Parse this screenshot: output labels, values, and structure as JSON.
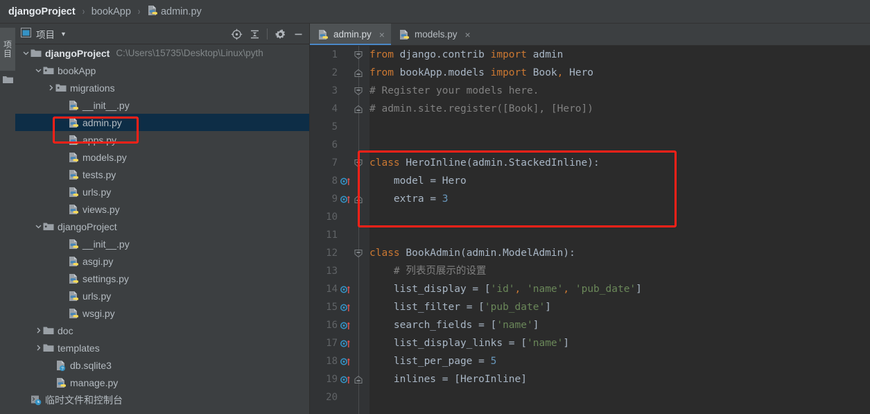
{
  "breadcrumb": {
    "items": [
      {
        "label": "djangoProject",
        "icon": null,
        "root": true
      },
      {
        "label": "bookApp",
        "icon": null,
        "root": false
      },
      {
        "label": "admin.py",
        "icon": "python-file-icon",
        "root": false
      }
    ],
    "separator": "›"
  },
  "toolstrip": {
    "project_tab_label": "项目",
    "folder_icon": "folder-icon"
  },
  "project_panel": {
    "title": "项目",
    "title_icon": "project-window-icon",
    "caret": "▼",
    "actions": [
      {
        "name": "select-opened-file-icon",
        "label": "Select Opened File"
      },
      {
        "name": "collapse-all-icon",
        "label": "Collapse All"
      },
      {
        "name": "settings-gear-icon",
        "label": "Settings"
      },
      {
        "name": "hide-panel-icon",
        "label": "Hide"
      }
    ],
    "tree": [
      {
        "indent": 0,
        "arrow": "down",
        "icon": "folder-icon",
        "label": "djangoProject",
        "bold": true,
        "path": "C:\\Users\\15735\\Desktop\\Linux\\pyth",
        "selected": false
      },
      {
        "indent": 1,
        "arrow": "down",
        "icon": "module-folder-icon",
        "label": "bookApp",
        "bold": false,
        "path": "",
        "selected": false
      },
      {
        "indent": 2,
        "arrow": "right",
        "icon": "module-folder-icon",
        "label": "migrations",
        "bold": false,
        "path": "",
        "selected": false
      },
      {
        "indent": 3,
        "arrow": "none",
        "icon": "python-file-icon",
        "label": "__init__.py",
        "bold": false,
        "path": "",
        "selected": false
      },
      {
        "indent": 3,
        "arrow": "none",
        "icon": "python-file-icon",
        "label": "admin.py",
        "bold": false,
        "path": "",
        "selected": true
      },
      {
        "indent": 3,
        "arrow": "none",
        "icon": "python-file-icon",
        "label": "apps.py",
        "bold": false,
        "path": "",
        "selected": false
      },
      {
        "indent": 3,
        "arrow": "none",
        "icon": "python-file-icon",
        "label": "models.py",
        "bold": false,
        "path": "",
        "selected": false
      },
      {
        "indent": 3,
        "arrow": "none",
        "icon": "python-file-icon",
        "label": "tests.py",
        "bold": false,
        "path": "",
        "selected": false
      },
      {
        "indent": 3,
        "arrow": "none",
        "icon": "python-file-icon",
        "label": "urls.py",
        "bold": false,
        "path": "",
        "selected": false
      },
      {
        "indent": 3,
        "arrow": "none",
        "icon": "python-file-icon",
        "label": "views.py",
        "bold": false,
        "path": "",
        "selected": false
      },
      {
        "indent": 1,
        "arrow": "down",
        "icon": "module-folder-icon",
        "label": "djangoProject",
        "bold": false,
        "path": "",
        "selected": false
      },
      {
        "indent": 3,
        "arrow": "none",
        "icon": "python-file-icon",
        "label": "__init__.py",
        "bold": false,
        "path": "",
        "selected": false
      },
      {
        "indent": 3,
        "arrow": "none",
        "icon": "python-file-icon",
        "label": "asgi.py",
        "bold": false,
        "path": "",
        "selected": false
      },
      {
        "indent": 3,
        "arrow": "none",
        "icon": "python-file-icon",
        "label": "settings.py",
        "bold": false,
        "path": "",
        "selected": false
      },
      {
        "indent": 3,
        "arrow": "none",
        "icon": "python-file-icon",
        "label": "urls.py",
        "bold": false,
        "path": "",
        "selected": false
      },
      {
        "indent": 3,
        "arrow": "none",
        "icon": "python-file-icon",
        "label": "wsgi.py",
        "bold": false,
        "path": "",
        "selected": false
      },
      {
        "indent": 1,
        "arrow": "right",
        "icon": "folder-icon",
        "label": "doc",
        "bold": false,
        "path": "",
        "selected": false
      },
      {
        "indent": 1,
        "arrow": "right",
        "icon": "folder-icon",
        "label": "templates",
        "bold": false,
        "path": "",
        "selected": false
      },
      {
        "indent": 2,
        "arrow": "none",
        "icon": "unknown-file-icon",
        "label": "db.sqlite3",
        "bold": false,
        "path": "",
        "selected": false
      },
      {
        "indent": 2,
        "arrow": "none",
        "icon": "python-file-icon",
        "label": "manage.py",
        "bold": false,
        "path": "",
        "selected": false
      },
      {
        "indent": 0,
        "arrow": "none",
        "icon": "scratches-icon",
        "label": "临时文件和控制台",
        "bold": false,
        "path": "",
        "selected": false
      }
    ]
  },
  "editor": {
    "tabs": [
      {
        "label": "admin.py",
        "icon": "python-file-icon",
        "active": true,
        "close": "×"
      },
      {
        "label": "models.py",
        "icon": "python-file-icon",
        "active": false,
        "close": "×"
      }
    ],
    "lines": [
      {
        "num": "1",
        "fold": "open",
        "over": false,
        "tokens": [
          {
            "t": "from",
            "c": "kw"
          },
          {
            "t": " django.contrib ",
            "c": "id"
          },
          {
            "t": "import",
            "c": "kw"
          },
          {
            "t": " admin",
            "c": "id"
          }
        ]
      },
      {
        "num": "2",
        "fold": "close",
        "over": false,
        "tokens": [
          {
            "t": "from",
            "c": "kw"
          },
          {
            "t": " bookApp.models ",
            "c": "id"
          },
          {
            "t": "import",
            "c": "kw"
          },
          {
            "t": " Book",
            "c": "id"
          },
          {
            "t": ",",
            "c": "comma"
          },
          {
            "t": " Hero",
            "c": "id"
          }
        ]
      },
      {
        "num": "3",
        "fold": "open",
        "over": false,
        "tokens": [
          {
            "t": "# Register your models here.",
            "c": "cmt"
          }
        ]
      },
      {
        "num": "4",
        "fold": "close",
        "over": false,
        "tokens": [
          {
            "t": "# admin.site.register([Book], [Hero])",
            "c": "cmt"
          }
        ]
      },
      {
        "num": "5",
        "fold": "none",
        "over": false,
        "tokens": []
      },
      {
        "num": "6",
        "fold": "none",
        "over": false,
        "tokens": []
      },
      {
        "num": "7",
        "fold": "open",
        "over": false,
        "tokens": [
          {
            "t": "class",
            "c": "kw"
          },
          {
            "t": " HeroInline",
            "c": "cls"
          },
          {
            "t": "(admin.StackedInline):",
            "c": "pun"
          }
        ]
      },
      {
        "num": "8",
        "fold": "none",
        "over": true,
        "tokens": [
          {
            "t": "    model ",
            "c": "id"
          },
          {
            "t": "=",
            "c": "pun"
          },
          {
            "t": " Hero",
            "c": "id"
          }
        ]
      },
      {
        "num": "9",
        "fold": "close",
        "over": true,
        "tokens": [
          {
            "t": "    extra ",
            "c": "id"
          },
          {
            "t": "=",
            "c": "pun"
          },
          {
            "t": " ",
            "c": "id"
          },
          {
            "t": "3",
            "c": "num"
          }
        ]
      },
      {
        "num": "10",
        "fold": "none",
        "over": false,
        "tokens": []
      },
      {
        "num": "11",
        "fold": "none",
        "over": false,
        "tokens": []
      },
      {
        "num": "12",
        "fold": "open",
        "over": false,
        "tokens": [
          {
            "t": "class",
            "c": "kw"
          },
          {
            "t": " BookAdmin",
            "c": "cls"
          },
          {
            "t": "(admin.ModelAdmin):",
            "c": "pun"
          }
        ]
      },
      {
        "num": "13",
        "fold": "none",
        "over": false,
        "tokens": [
          {
            "t": "    # 列表页展示的设置",
            "c": "cmt"
          }
        ]
      },
      {
        "num": "14",
        "fold": "none",
        "over": true,
        "tokens": [
          {
            "t": "    list_display ",
            "c": "id"
          },
          {
            "t": "=",
            "c": "pun"
          },
          {
            "t": " [",
            "c": "pun"
          },
          {
            "t": "'id'",
            "c": "str"
          },
          {
            "t": ",",
            "c": "comma"
          },
          {
            "t": " ",
            "c": "pun"
          },
          {
            "t": "'name'",
            "c": "str"
          },
          {
            "t": ",",
            "c": "comma"
          },
          {
            "t": " ",
            "c": "pun"
          },
          {
            "t": "'pub_date'",
            "c": "str"
          },
          {
            "t": "]",
            "c": "pun"
          }
        ]
      },
      {
        "num": "15",
        "fold": "none",
        "over": true,
        "tokens": [
          {
            "t": "    list_filter ",
            "c": "id"
          },
          {
            "t": "=",
            "c": "pun"
          },
          {
            "t": " [",
            "c": "pun"
          },
          {
            "t": "'pub_date'",
            "c": "str"
          },
          {
            "t": "]",
            "c": "pun"
          }
        ]
      },
      {
        "num": "16",
        "fold": "none",
        "over": true,
        "tokens": [
          {
            "t": "    search_fields ",
            "c": "id"
          },
          {
            "t": "=",
            "c": "pun"
          },
          {
            "t": " [",
            "c": "pun"
          },
          {
            "t": "'name'",
            "c": "str"
          },
          {
            "t": "]",
            "c": "pun"
          }
        ]
      },
      {
        "num": "17",
        "fold": "none",
        "over": true,
        "tokens": [
          {
            "t": "    list_display_links ",
            "c": "id"
          },
          {
            "t": "=",
            "c": "pun"
          },
          {
            "t": " [",
            "c": "pun"
          },
          {
            "t": "'name'",
            "c": "str"
          },
          {
            "t": "]",
            "c": "pun"
          }
        ]
      },
      {
        "num": "18",
        "fold": "none",
        "over": true,
        "tokens": [
          {
            "t": "    list_per_page ",
            "c": "id"
          },
          {
            "t": "=",
            "c": "pun"
          },
          {
            "t": " ",
            "c": "id"
          },
          {
            "t": "5",
            "c": "num"
          }
        ]
      },
      {
        "num": "19",
        "fold": "close",
        "over": true,
        "tokens": [
          {
            "t": "    inlines ",
            "c": "id"
          },
          {
            "t": "=",
            "c": "pun"
          },
          {
            "t": " [HeroInline]",
            "c": "pun"
          }
        ]
      },
      {
        "num": "20",
        "fold": "none",
        "over": false,
        "tokens": []
      }
    ]
  },
  "annotations": {
    "highlight_color": "#ff2118",
    "boxes": [
      {
        "name": "admin-py-tree-highlight",
        "target": "admin.py"
      },
      {
        "name": "heroinline-class-highlight",
        "target": "class HeroInline"
      }
    ]
  }
}
